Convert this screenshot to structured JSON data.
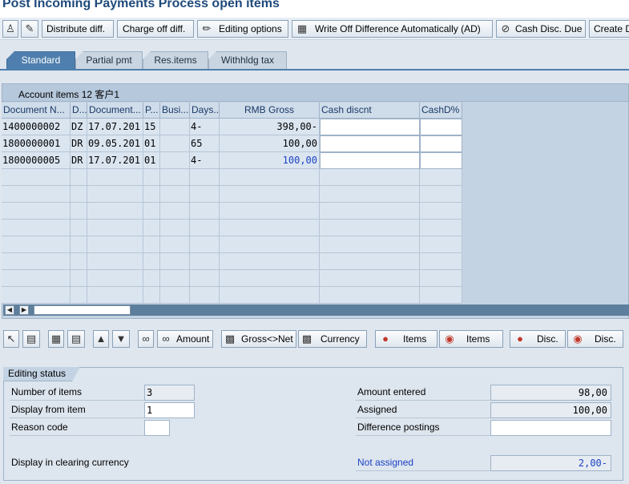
{
  "title": "Post Incoming Payments Process open items",
  "toolbar": {
    "distribute_diff": "Distribute diff.",
    "charge_off_diff": "Charge off diff.",
    "editing_options": "Editing options",
    "write_off_auto": "Write Off Difference Automatically (AD)",
    "cash_disc_due": "Cash Disc. Due",
    "create": "Create D"
  },
  "tabs": [
    "Standard",
    "Partial pmt",
    "Res.items",
    "Withhldg tax"
  ],
  "account_items": {
    "label": "Account items 12 客户1"
  },
  "columns": [
    "Document N...",
    "D...",
    "Document...",
    "P...",
    "Busi...",
    "Days...",
    "RMB Gross",
    "Cash discnt",
    "CashD%"
  ],
  "rows": [
    {
      "doc": "1400000002",
      "type": "DZ",
      "date": "17.07.201",
      "p": "15",
      "busi": "",
      "days": "4-",
      "gross": "398,00-",
      "cash": "",
      "cashd": ""
    },
    {
      "doc": "1800000001",
      "type": "DR",
      "date": "09.05.201",
      "p": "01",
      "busi": "",
      "days": "65",
      "gross": "100,00",
      "cash": "",
      "cashd": ""
    },
    {
      "doc": "1800000005",
      "type": "DR",
      "date": "17.07.201",
      "p": "01",
      "busi": "",
      "days": "4-",
      "gross": "100,00",
      "cash": "",
      "cashd": ""
    }
  ],
  "toolbar2": {
    "amount": "Amount",
    "gross_net": "Gross<>Net",
    "currency": "Currency",
    "items1": "Items",
    "items2": "Items",
    "disc1": "Disc.",
    "disc2": "Disc."
  },
  "editing_status": {
    "title": "Editing status",
    "number_of_items_label": "Number of items",
    "number_of_items": "3",
    "display_from_item_label": "Display from item",
    "display_from_item": "1",
    "reason_code_label": "Reason code",
    "reason_code": "",
    "display_clearing_label": "Display in clearing currency",
    "amount_entered_label": "Amount entered",
    "amount_entered": "98,00",
    "assigned_label": "Assigned",
    "assigned": "100,00",
    "difference_postings_label": "Difference postings",
    "difference_postings": "",
    "not_assigned_label": "Not assigned",
    "not_assigned": "2,00-"
  }
}
